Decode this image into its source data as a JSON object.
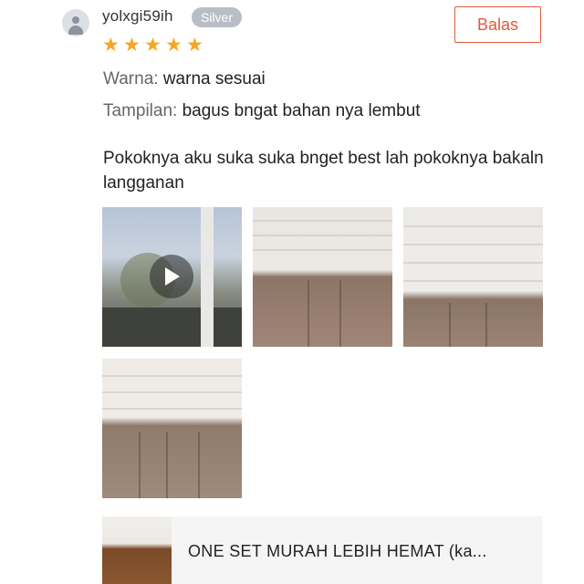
{
  "review": {
    "username": "yolxgi59ih",
    "badge": "Silver",
    "reply_label": "Balas",
    "rating": 5,
    "attributes": [
      {
        "key": "Warna:",
        "value": "warna sesuai"
      },
      {
        "key": "Tampilan:",
        "value": "bagus bngat bahan nya lembut"
      }
    ],
    "comment": "Pokoknya aku suka suka bnget best lah pokoknya bakaln langganan",
    "media": [
      {
        "type": "video",
        "icon": "play-icon"
      },
      {
        "type": "photo"
      },
      {
        "type": "photo"
      },
      {
        "type": "photo"
      }
    ]
  },
  "product": {
    "title": "ONE SET MURAH LEBIH HEMAT (ka..."
  },
  "colors": {
    "accent": "#e05a3c",
    "star": "#f5a623",
    "badge": "#b9bec6"
  }
}
